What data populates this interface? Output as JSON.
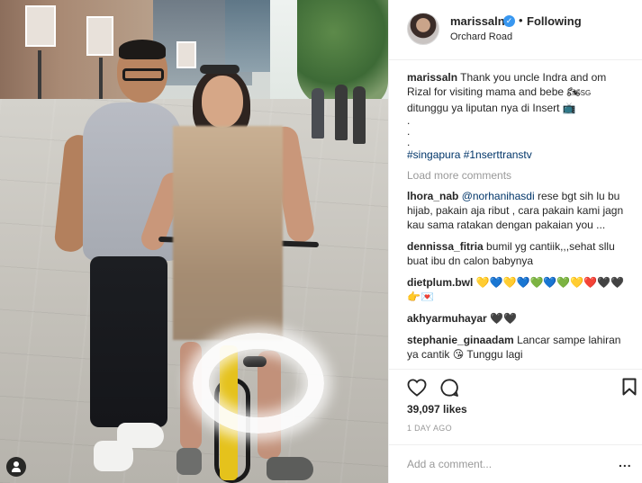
{
  "header": {
    "username": "marissaln",
    "verified_glyph": "✓",
    "separator": "•",
    "follow_status": "Following",
    "location": "Orchard Road"
  },
  "caption": {
    "username": "marissaln",
    "text_1": "Thank you uncle Indra and om Rizal for visiting mama and bebe",
    "emoji_1": "🏍",
    "sg": "SG",
    "text_2": "ditunggu ya liputan nya di Insert",
    "emoji_2": "📺",
    "dots": [
      ".",
      ".",
      "."
    ],
    "hashtags": "#singapura #1nserttranstv"
  },
  "load_more": "Load more comments",
  "comments": [
    {
      "user": "lhora_nab",
      "mention": "@norhanihasdi",
      "text": "rese bgt sih lu bu hijab, pakain aja ribut , cara pakain kami jagn kau sama ratakan dengan pakaian you ..."
    },
    {
      "user": "dennissa_fitria",
      "mention": "",
      "text": "bumil yg cantiik,,,sehat sllu buat ibu dn calon babynya"
    },
    {
      "user": "dietplum.bwl",
      "mention": "",
      "text": "💛💙💛💙💚💙💚💛❤️🖤🖤👉💌"
    },
    {
      "user": "akhyarmuhayar",
      "mention": "",
      "text": "🖤🖤"
    },
    {
      "user": "stephanie_ginaadam",
      "mention": "",
      "text": "Lancar sampe lahiran ya cantik 😘 Tunggu lagi"
    }
  ],
  "actions": {
    "like_icon": "heart-outline",
    "comment_icon": "speech-bubble",
    "save_icon": "bookmark-outline"
  },
  "likes": "39,097 likes",
  "time_ago": "1 DAY AGO",
  "add_comment": {
    "placeholder": "Add a comment...",
    "more": "..."
  },
  "colors": {
    "verified": "#3897f0",
    "link": "#003569",
    "muted": "#999999",
    "border": "#efefef"
  }
}
